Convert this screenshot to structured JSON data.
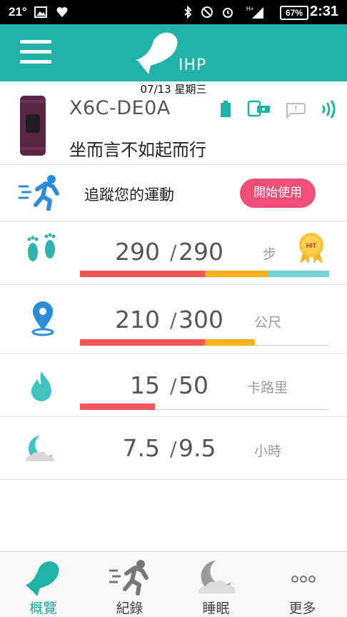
{
  "status_bar": {
    "temperature": "21°",
    "battery": "67%",
    "time": "2:31"
  },
  "header": {
    "logo_text": "IHP"
  },
  "date": "07/13 星期三",
  "device": {
    "name": "X6C-DE0A",
    "motto": "坐而言不如起而行"
  },
  "track": {
    "label": "追蹤您的運動",
    "button": "開始使用"
  },
  "metrics": [
    {
      "icon": "footprints-icon",
      "value": "290",
      "goal": "290",
      "unit": "步",
      "badge": "HIT"
    },
    {
      "icon": "location-pin-icon",
      "value": "210",
      "goal": "300",
      "unit": "公尺"
    },
    {
      "icon": "flame-icon",
      "value": "15",
      "goal": "50",
      "unit": "卡路里"
    },
    {
      "icon": "moon-cloud-icon",
      "value": "7.5",
      "goal": "9.5",
      "unit": "小時"
    }
  ],
  "nav": [
    {
      "label": "概覽",
      "icon": "overview-icon",
      "active": true
    },
    {
      "label": "紀錄",
      "icon": "record-runner-icon",
      "active": false
    },
    {
      "label": "睡眠",
      "icon": "sleep-icon",
      "active": false
    },
    {
      "label": "更多",
      "icon": "more-icon",
      "active": false
    }
  ],
  "colors": {
    "accent": "#20b2a6",
    "button": "#ef4f77",
    "bar_red": "#f25656",
    "bar_orange": "#f6b11c",
    "bar_teal": "#74d3d5"
  }
}
